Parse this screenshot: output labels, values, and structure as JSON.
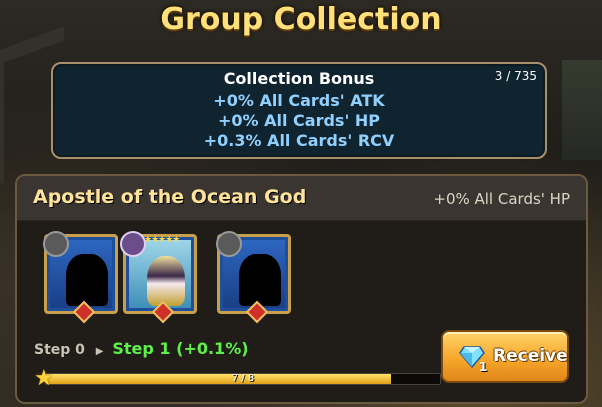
{
  "title": "Group Collection",
  "collection_bonus": {
    "title": "Collection Bonus",
    "count": "3 / 735",
    "lines": [
      "+0% All Cards' ATK",
      "+0% All Cards' HP",
      "+0.3% All Cards' RCV"
    ]
  },
  "group": {
    "name": "Apostle of the Ocean God",
    "bonus": "+0% All Cards' HP",
    "cards": [
      {
        "state": "locked",
        "type_icon": "axe-icon"
      },
      {
        "state": "owned",
        "type_icon": "dark-element-icon",
        "stars": "★★★★★"
      },
      {
        "state": "locked",
        "type_icon": "eagle-icon"
      }
    ],
    "step_prev": "Step 0",
    "step_current": "Step 1 (+0.1%)",
    "progress_text": "7 / 8",
    "progress_fraction": 0.875,
    "receive": {
      "label": "Receive",
      "cost": "1"
    }
  }
}
